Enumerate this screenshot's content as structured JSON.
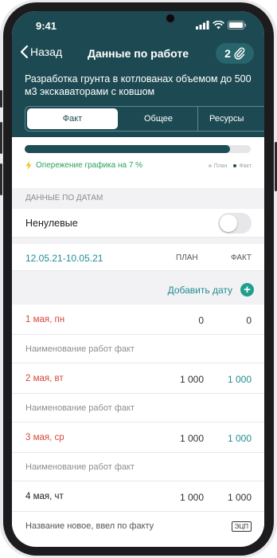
{
  "status": {
    "time": "9:41"
  },
  "nav": {
    "back_label": "Назад",
    "title": "Данные по работе",
    "attachments_count": "2"
  },
  "task": {
    "subtitle": "Разработка грунта в котлованах объемом до 500 м3 экскаваторами  с  ковшом"
  },
  "tabs": [
    {
      "label": "Факт"
    },
    {
      "label": "Общее"
    },
    {
      "label": "Ресурсы"
    }
  ],
  "progress": {
    "fill_fraction": 0.91,
    "status_text": "Опережение графика на 7 %",
    "legend_plan": "План",
    "legend_fact": "Факт",
    "bolt_icon": "bolt-icon"
  },
  "section": {
    "title": "ДАННЫЕ ПО ДАТАМ"
  },
  "filter": {
    "label": "Ненулевые",
    "enabled": false
  },
  "range": {
    "label": "12.05.21-10.05.21",
    "plan_header": "ПЛАН",
    "fact_header": "ФАКТ"
  },
  "add": {
    "label": "Добавить дату"
  },
  "days": [
    {
      "date": "1 мая, пн",
      "plan": "0",
      "fact": "0",
      "work": "Наименование работ факт"
    },
    {
      "date": "2 мая, вт",
      "plan": "1 000",
      "fact": "1 000",
      "work": "Наименование работ факт"
    },
    {
      "date": "3 мая, ср",
      "plan": "1 000",
      "fact": "1 000",
      "work": "Наименование работ факт"
    },
    {
      "date": "4 мая, чт",
      "plan": "1 000",
      "fact": "1 000",
      "work": "Название новое, ввел по факту",
      "badge": "ЭЦП"
    }
  ],
  "colors": {
    "header_bg": "#1d4a52",
    "accent": "#1f8d92",
    "weekend_red": "#d9473f",
    "ahead_green": "#2aa25a"
  }
}
